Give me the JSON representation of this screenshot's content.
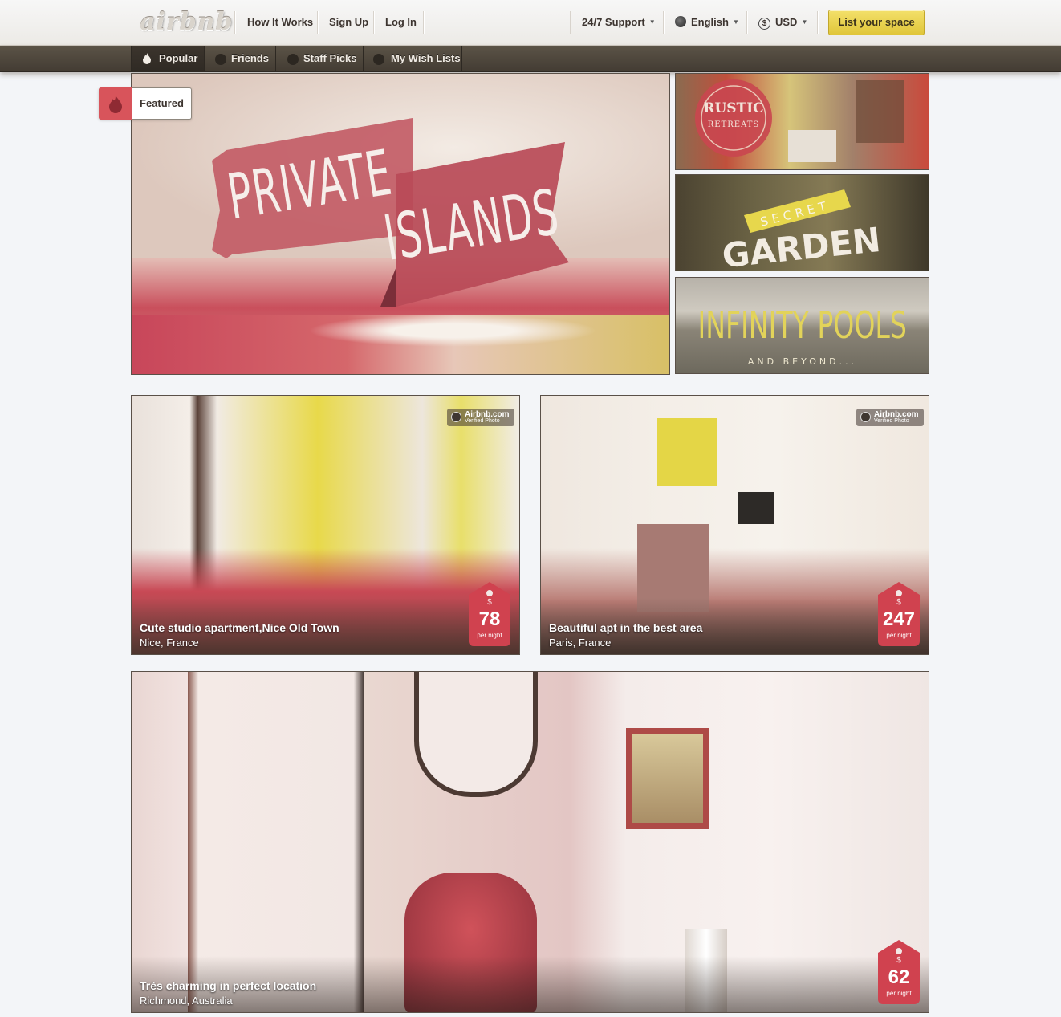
{
  "header": {
    "logo": "airbnb",
    "links": [
      "How It Works",
      "Sign Up",
      "Log In"
    ],
    "support": "24/7 Support",
    "language": "English",
    "currency": "USD",
    "currency_symbol": "$",
    "list_button": "List your space"
  },
  "nav": {
    "tabs": [
      "Popular",
      "Friends",
      "Staff Picks",
      "My Wish Lists"
    ],
    "active": "Popular"
  },
  "featured": {
    "badge": "Featured",
    "hero": {
      "line1": "PRIVATE",
      "line2": "ISLANDS"
    },
    "side": [
      {
        "line1": "RUSTIC",
        "line2": "RETREATS"
      },
      {
        "line1": "SECRET",
        "line2": "GARDEN"
      },
      {
        "line1": "INFINITY POOLS",
        "line2": "AND BEYOND..."
      }
    ]
  },
  "verified": {
    "line1": "Airbnb.com",
    "line2": "Verified Photo"
  },
  "listings": [
    {
      "title": "Cute studio apartment,Nice Old Town",
      "location": "Nice, France",
      "currency_symbol": "$",
      "price": "78",
      "unit": "per night"
    },
    {
      "title": "Beautiful apt in the best area",
      "location": "Paris, France",
      "currency_symbol": "$",
      "price": "247",
      "unit": "per night"
    },
    {
      "title": "Très charming in perfect location",
      "location": "Richmond, Australia",
      "currency_symbol": "$",
      "price": "62",
      "unit": "per night"
    }
  ],
  "colors": {
    "accent_red": "#d0424f",
    "list_button": "#ecd450",
    "nav_dark": "#4f483e"
  }
}
